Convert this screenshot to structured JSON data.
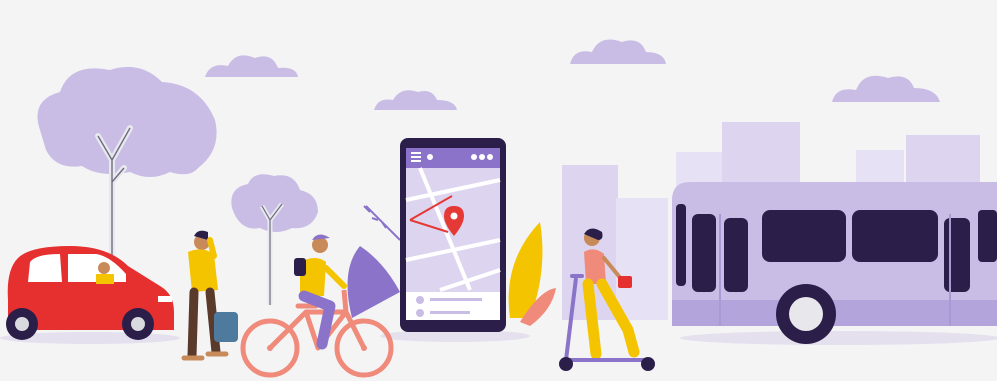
{
  "palette": {
    "background": "#f4f4f5",
    "lavender": "#c9bde6",
    "lavender_light": "#ddd5f0",
    "purple": "#8a73c9",
    "purple_dark": "#5a45a0",
    "navy": "#2b1f4a",
    "car_red": "#e63030",
    "yellow": "#f5c400",
    "skin": "#c98a5a",
    "map_pin": "#e53935"
  },
  "illustration": {
    "subjects": [
      "car-icon",
      "pedestrian-icon",
      "cyclist-icon",
      "smartphone-map-icon",
      "map-pin-icon",
      "scooter-rider-icon",
      "bus-icon",
      "tree-icon",
      "cloud-icon",
      "city-skyline-icon"
    ]
  }
}
